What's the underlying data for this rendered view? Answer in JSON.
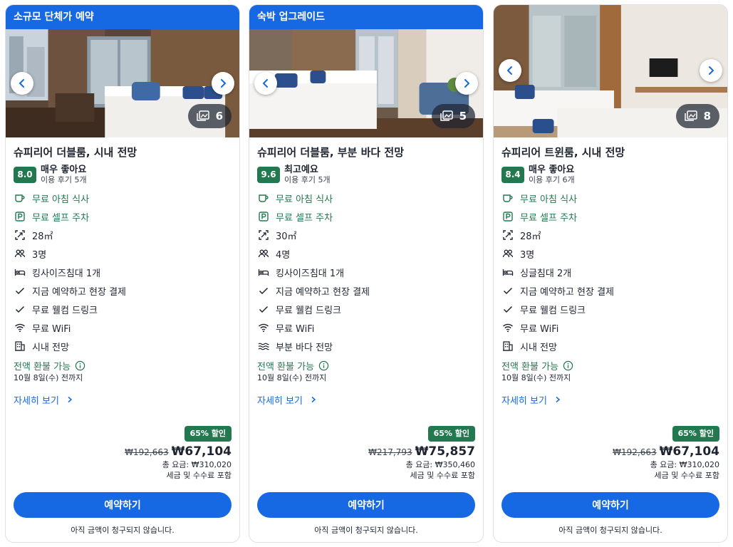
{
  "colors": {
    "primary": "#1668e3",
    "positive": "#227950",
    "text": "#1f2530"
  },
  "cards": [
    {
      "banner": "소규모 단체가 예약",
      "photo_count": "6",
      "title": "슈피리어 더블룸, 시내 전망",
      "score": "8.0",
      "rating_label": "매우 좋아요",
      "review_count": "이용 후기 5개",
      "amenities": [
        {
          "icon": "coffee-cup-icon",
          "label": "무료 아침 식사",
          "highlight": true
        },
        {
          "icon": "parking-icon",
          "label": "무료 셀프 주차",
          "highlight": true
        },
        {
          "icon": "room-size-icon",
          "label": "28㎡"
        },
        {
          "icon": "people-icon",
          "label": "3명"
        },
        {
          "icon": "bed-icon",
          "label": "킹사이즈침대 1개"
        },
        {
          "icon": "checkmark-icon",
          "label": "지금 예약하고 현장 결제"
        },
        {
          "icon": "checkmark-icon",
          "label": "무료 웰컴 드링크"
        },
        {
          "icon": "wifi-icon",
          "label": "무료 WiFi"
        },
        {
          "icon": "city-building-icon",
          "label": "시내 전망"
        }
      ],
      "refund": "전액 환불 가능",
      "refund_deadline": "10월 8일(수) 전까지",
      "details_link": "자세히 보기",
      "discount": "65% 할인",
      "old_price": "₩192,663",
      "price": "₩67,104",
      "total": "총 요금: ₩310,020",
      "tax_note": "세금 및 수수료 포함",
      "book_button": "예약하기",
      "no_charge_note": "아직 금액이 청구되지 않습니다."
    },
    {
      "banner": "숙박 업그레이드",
      "photo_count": "5",
      "title": "슈피리어 더블룸, 부분 바다 전망",
      "score": "9.6",
      "rating_label": "최고예요",
      "review_count": "이용 후기 5개",
      "amenities": [
        {
          "icon": "coffee-cup-icon",
          "label": "무료 아침 식사",
          "highlight": true
        },
        {
          "icon": "parking-icon",
          "label": "무료 셀프 주차",
          "highlight": true
        },
        {
          "icon": "room-size-icon",
          "label": "30㎡"
        },
        {
          "icon": "people-icon",
          "label": "4명"
        },
        {
          "icon": "bed-icon",
          "label": "킹사이즈침대 1개"
        },
        {
          "icon": "checkmark-icon",
          "label": "지금 예약하고 현장 결제"
        },
        {
          "icon": "checkmark-icon",
          "label": "무료 웰컴 드링크"
        },
        {
          "icon": "wifi-icon",
          "label": "무료 WiFi"
        },
        {
          "icon": "waves-icon",
          "label": "부분 바다 전망"
        }
      ],
      "refund": "전액 환불 가능",
      "refund_deadline": "10월 8일(수) 전까지",
      "details_link": "자세히 보기",
      "discount": "65% 할인",
      "old_price": "₩217,793",
      "price": "₩75,857",
      "total": "총 요금: ₩350,460",
      "tax_note": "세금 및 수수료 포함",
      "book_button": "예약하기",
      "no_charge_note": "아직 금액이 청구되지 않습니다."
    },
    {
      "banner": "",
      "photo_count": "8",
      "title": "슈피리어 트윈룸, 시내 전망",
      "score": "8.4",
      "rating_label": "매우 좋아요",
      "review_count": "이용 후기 6개",
      "amenities": [
        {
          "icon": "coffee-cup-icon",
          "label": "무료 아침 식사",
          "highlight": true
        },
        {
          "icon": "parking-icon",
          "label": "무료 셀프 주차",
          "highlight": true
        },
        {
          "icon": "room-size-icon",
          "label": "28㎡"
        },
        {
          "icon": "people-icon",
          "label": "3명"
        },
        {
          "icon": "bed-icon",
          "label": "싱글침대 2개"
        },
        {
          "icon": "checkmark-icon",
          "label": "지금 예약하고 현장 결제"
        },
        {
          "icon": "checkmark-icon",
          "label": "무료 웰컴 드링크"
        },
        {
          "icon": "wifi-icon",
          "label": "무료 WiFi"
        },
        {
          "icon": "city-building-icon",
          "label": "시내 전망"
        }
      ],
      "refund": "전액 환불 가능",
      "refund_deadline": "10월 8일(수) 전까지",
      "details_link": "자세히 보기",
      "discount": "65% 할인",
      "old_price": "₩192,663",
      "price": "₩67,104",
      "total": "총 요금: ₩310,020",
      "tax_note": "세금 및 수수료 포함",
      "book_button": "예약하기",
      "no_charge_note": "아직 금액이 청구되지 않습니다."
    }
  ]
}
